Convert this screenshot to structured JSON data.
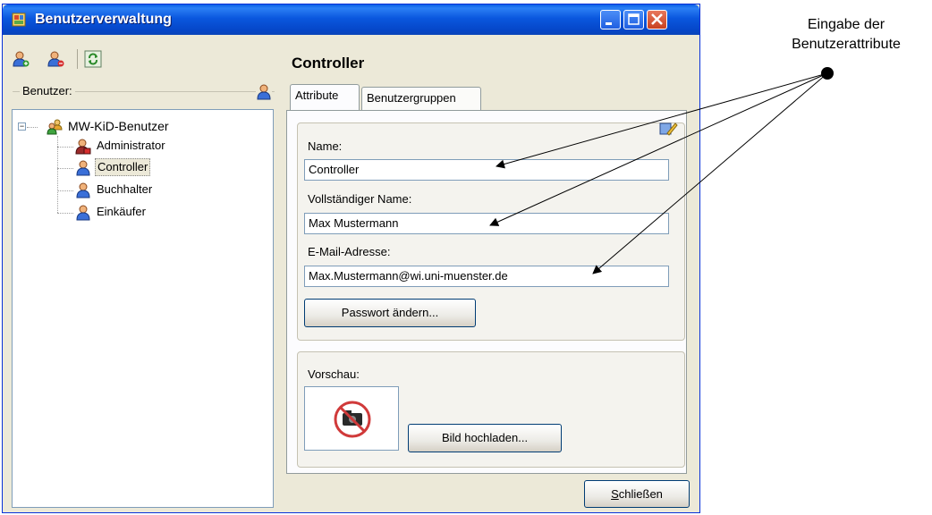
{
  "window": {
    "title": "Benutzerverwaltung",
    "controls": [
      "minimize",
      "maximize",
      "close"
    ]
  },
  "toolbar": {
    "icons": [
      "add-user-icon",
      "remove-user-icon",
      "refresh-icon"
    ]
  },
  "users_group": {
    "label": "Benutzer:",
    "tree": {
      "root": "MW-KiD-Benutzer",
      "items": [
        {
          "label": "Administrator",
          "icon": "admin-user-icon"
        },
        {
          "label": "Controller",
          "icon": "user-icon",
          "selected": true
        },
        {
          "label": "Buchhalter",
          "icon": "user-icon"
        },
        {
          "label": "Einkäufer",
          "icon": "user-icon"
        }
      ]
    }
  },
  "detail": {
    "heading": "Controller",
    "tabs": [
      "Attribute",
      "Benutzergruppen"
    ],
    "active_tab": "Attribute",
    "fields": {
      "name_label": "Name:",
      "name_value": "Controller",
      "fullname_label": "Vollständiger Name:",
      "fullname_value": "Max Mustermann",
      "email_label": "E-Mail-Adresse:",
      "email_value": "Max.Mustermann@wi.uni-muenster.de"
    },
    "password_button": "Passwort ändern...",
    "preview": {
      "label": "Vorschau:",
      "image": "no-camera-icon",
      "upload_button": "Bild hochladen..."
    }
  },
  "footer": {
    "close_button_mnemonic": "S",
    "close_button_rest": "chließen"
  },
  "annotation": {
    "line1": "Eingabe der",
    "line2": "Benutzerattribute"
  },
  "colors": {
    "titlebar": "#0a57de",
    "window_face": "#ece9d8",
    "field_border": "#7f9db9"
  }
}
